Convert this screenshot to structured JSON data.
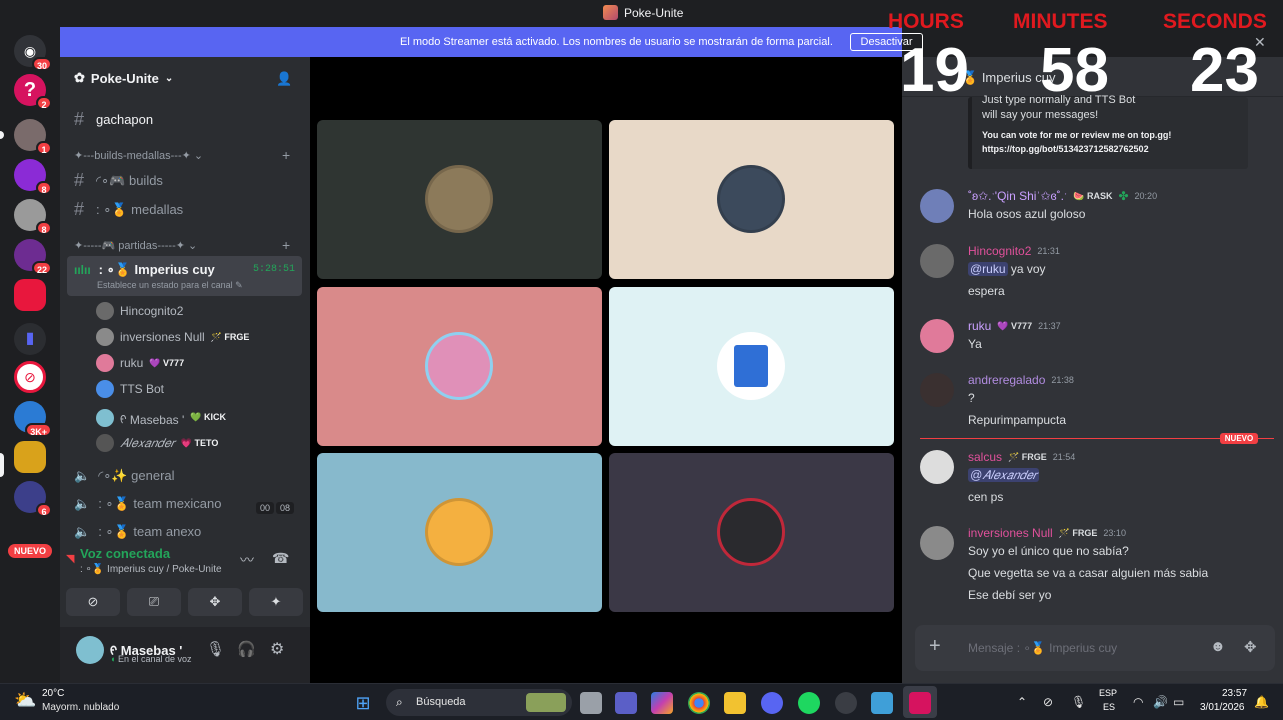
{
  "window": {
    "title": "Poke-Unite"
  },
  "banner": {
    "text": "El modo Streamer está activado. Los nombres de usuario se mostrarán de forma parcial.",
    "button": "Desactivar"
  },
  "rail": {
    "badges": [
      "30",
      "2",
      "1",
      "8",
      "8",
      "22",
      "3K+",
      "6"
    ],
    "nuevo": "NUEVO"
  },
  "guild": {
    "name": "Poke-Unite"
  },
  "channels": {
    "gachapon": "gachapon",
    "cat_builds": "✦---builds-medallas---✦",
    "builds": "◜∘🎮 builds",
    "medallas": ": ∘🏅 medallas",
    "cat_partidas": "✦-----🎮 partidas-----✦",
    "voice_active": ": ∘🏅 Imperius cuy",
    "voice_timer": "5:28:51",
    "voice_status": "Establece un estado para el canal",
    "general": "◜∘✨ general",
    "team_mexicano": ": ∘🏅 team mexicano",
    "team_mexicano_c1": "00",
    "team_mexicano_c2": "08",
    "team_anexo": ": ∘🏅 team anexo"
  },
  "voice_users": [
    {
      "name": "Hincognito2",
      "tag": ""
    },
    {
      "name": "inversiones Null",
      "tag": "🪄 FRGE"
    },
    {
      "name": "ruku",
      "tag": "💜 V777"
    },
    {
      "name": "TTS Bot",
      "tag": ""
    },
    {
      "name": "ᠻ Masebas '",
      "tag": "💚 KICK"
    },
    {
      "name": "𝐴𝑙𝑒𝑥𝑎𝑛𝑑𝑒𝑟",
      "tag": "💗 TETO"
    }
  ],
  "voice_panel": {
    "status": "Voz conectada",
    "channel": ": ∘🏅 Imperius cuy / Poke-Unite"
  },
  "user_panel": {
    "name": "ᠻ Masebas '",
    "status": "En el canal de voz"
  },
  "chat": {
    "channel": "Imperius cuy",
    "embed_line1": "Just type normally and TTS Bot",
    "embed_line2": "will say your messages!",
    "embed_line3": "You can vote for me or review me on top.gg!",
    "embed_line4": "https://top.gg/bot/513423712582762502",
    "messages": [
      {
        "author": "˚ʚ✩.ˑ'Qin Shiʾ✩ɞ˚.ˑ",
        "tag": "🍉 RASK",
        "time": "20:20",
        "lines": [
          "Hola osos azul goloso"
        ]
      },
      {
        "author": "Hincognito2",
        "tag": "",
        "time": "21:31",
        "mention": "@ruku",
        "lines": [
          "ya voy",
          "espera"
        ]
      },
      {
        "author": "ruku",
        "tag": "💜 V777",
        "time": "21:37",
        "lines": [
          "Ya"
        ]
      },
      {
        "author": "andreregalado",
        "tag": "",
        "time": "21:38",
        "lines": [
          "?",
          "Repurimpampucta"
        ]
      },
      {
        "author": "salcus",
        "tag": "🪄 FRGE",
        "time": "21:54",
        "mention": "@𝐴𝑙𝑒𝑥𝑎𝑛𝑑𝑒𝑟",
        "lines": [
          "cen ps"
        ]
      },
      {
        "author": "inversiones Null",
        "tag": "🪄 FRGE",
        "time": "23:10",
        "lines": [
          "Soy yo el único que no sabía?",
          "Que vegetta se va a casar alguien más sabia",
          "Ese debí ser yo"
        ]
      }
    ],
    "new_label": "NUEVO",
    "composer_placeholder": "Mensaje  : ∘🏅 Imperius cuy"
  },
  "timer": {
    "hours_label": "HOURS",
    "minutes_label": "MINUTES",
    "seconds_label": "SECONDS",
    "hours": "19",
    "minutes": "58",
    "seconds": "23"
  },
  "taskbar": {
    "weather_temp": "20°C",
    "weather_desc": "Mayorm. nublado",
    "search": "Búsqueda",
    "lang1": "ESP",
    "lang2": "ES",
    "time": "23:57",
    "date": "3/01/2026"
  },
  "colors": {
    "blurple": "#5865f2",
    "red": "#f23f43",
    "green": "#23a55a",
    "pink_name": "#e0519b"
  }
}
